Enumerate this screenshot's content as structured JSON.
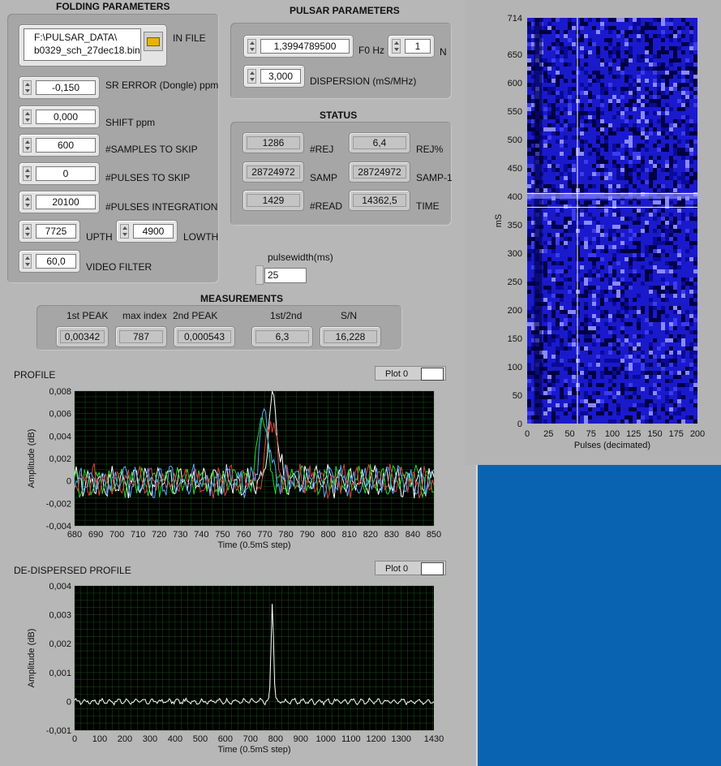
{
  "folding": {
    "title": "FOLDING PARAMETERS",
    "in_file_label": "IN FILE",
    "in_file_path_line1": "F:\\PULSAR_DATA\\",
    "in_file_path_line2": "b0329_sch_27dec18.bin",
    "sr_error_label": "SR ERROR (Dongle) ppm",
    "sr_error_value": "-0,150",
    "shift_label": "SHIFT ppm",
    "shift_value": "0,000",
    "samples_skip_label": "#SAMPLES TO SKIP",
    "samples_skip_value": "600",
    "pulses_skip_label": "#PULSES TO SKIP",
    "pulses_skip_value": "0",
    "pulses_int_label": "#PULSES INTEGRATION",
    "pulses_int_value": "20100",
    "upth_label": "UPTH",
    "upth_value": "7725",
    "lowth_label": "LOWTH",
    "lowth_value": "4900",
    "video_filter_label": "VIDEO FILTER",
    "video_filter_value": "60,0"
  },
  "pulsar": {
    "title": "PULSAR PARAMETERS",
    "f0_label": "F0 Hz",
    "f0_value": "1,3994789500",
    "n_label": "N",
    "n_value": "1",
    "dispersion_label": "DISPERSION (mS/MHz)",
    "dispersion_value": "3,000"
  },
  "status": {
    "title": "STATUS",
    "rej_label": "#REJ",
    "rej_value": "1286",
    "rejpct_label": "REJ%",
    "rejpct_value": "6,4",
    "samp_label": "SAMP",
    "samp_value": "28724972",
    "samp1_label": "SAMP-1",
    "samp1_value": "28724972",
    "read_label": "#READ",
    "read_value": "1429",
    "time_label": "TIME",
    "time_value": "14362,5"
  },
  "pulsewidth": {
    "label": "pulsewidth(ms)",
    "value": "25"
  },
  "measurements": {
    "title": "MEASUREMENTS",
    "first_peak_label": "1st PEAK",
    "first_peak_value": "0,00342",
    "max_index_label": "max index",
    "max_index_value": "787",
    "second_peak_label": "2nd PEAK",
    "second_peak_value": "0,000543",
    "ratio_label": "1st/2nd",
    "ratio_value": "6,3",
    "sn_label": "S/N",
    "sn_value": "16,228"
  },
  "profile": {
    "title": "PROFILE",
    "plot_legend": "Plot 0"
  },
  "dedispersed": {
    "title": "DE-DISPERSED PROFILE",
    "plot_legend": "Plot 0"
  },
  "colors": {
    "plot_bg": "#000000",
    "grid": "#1d7a1d",
    "waterfall": "#1a1acc",
    "desktop": "#0a63b0"
  },
  "chart_data": [
    {
      "type": "line",
      "title": "PROFILE",
      "xlabel": "Time (0.5mS step)",
      "ylabel": "Amplitude (dB)",
      "xlim": [
        680,
        850
      ],
      "ylim": [
        -0.004,
        0.008
      ],
      "xticks": [
        "680",
        "690",
        "700",
        "710",
        "720",
        "730",
        "740",
        "750",
        "760",
        "770",
        "780",
        "790",
        "800",
        "810",
        "820",
        "830",
        "840",
        "850"
      ],
      "yticks": [
        "-0,004",
        "-0,002",
        "0",
        "0,002",
        "0,004",
        "0,006",
        "0,008"
      ],
      "grid": true,
      "series": [
        {
          "color": "#ffffff",
          "peak_x": 774,
          "peak_y": 0.0073
        },
        {
          "color": "#22dd22",
          "peak_x": 769,
          "peak_y": 0.0062
        },
        {
          "color": "#e04040",
          "peak_x": 773,
          "peak_y": 0.0058
        },
        {
          "color": "#55aaff",
          "peak_x": 770,
          "peak_y": 0.006
        }
      ]
    },
    {
      "type": "line",
      "title": "DE-DISPERSED PROFILE",
      "xlabel": "Time (0.5mS step)",
      "ylabel": "Amplitude (dB)",
      "xlim": [
        0,
        1430
      ],
      "ylim": [
        -0.001,
        0.004
      ],
      "xticks": [
        "0",
        "100",
        "200",
        "300",
        "400",
        "500",
        "600",
        "700",
        "800",
        "900",
        "1000",
        "1100",
        "1200",
        "1300",
        "1430"
      ],
      "yticks": [
        "-0,001",
        "0",
        "0,001",
        "0,002",
        "0,003",
        "0,004"
      ],
      "grid": true,
      "series": [
        {
          "color": "#ffffff",
          "peak_x": 787,
          "peak_y": 0.00342
        }
      ]
    },
    {
      "type": "heatmap",
      "xlabel": "Pulses (decimated)",
      "ylabel": "mS",
      "xlim": [
        0,
        200
      ],
      "ylim": [
        0,
        714
      ],
      "xticks": [
        "0",
        "25",
        "50",
        "75",
        "100",
        "125",
        "150",
        "175",
        "200"
      ],
      "yticks": [
        "0",
        "50",
        "100",
        "150",
        "200",
        "250",
        "300",
        "350",
        "400",
        "450",
        "500",
        "550",
        "600",
        "650",
        "714"
      ],
      "cursor": {
        "x": 59,
        "y": 405
      }
    }
  ]
}
